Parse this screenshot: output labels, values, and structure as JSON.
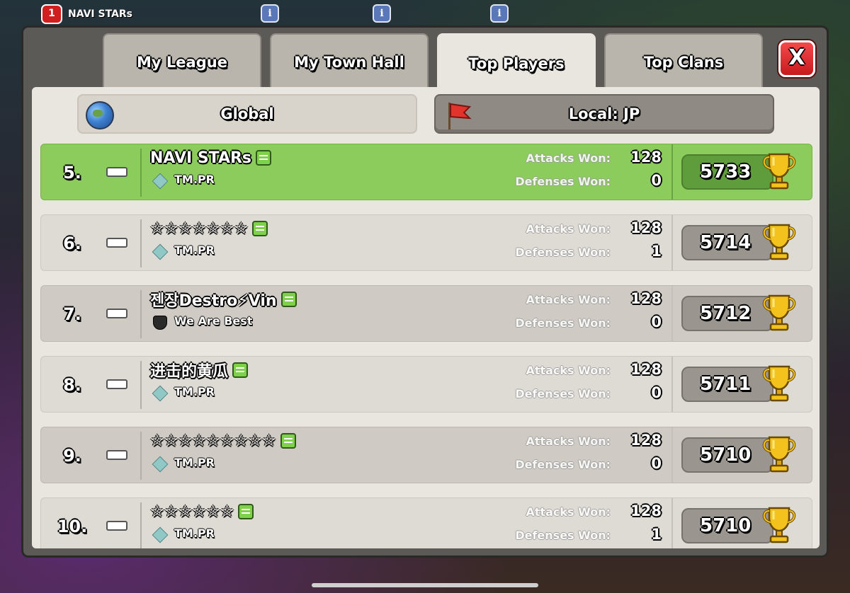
{
  "top": {
    "notification_count": "1",
    "player_name": "NAVI STARs"
  },
  "tabs": [
    {
      "label": "My League"
    },
    {
      "label": "My Town Hall"
    },
    {
      "label": "Top Players"
    },
    {
      "label": "Top Clans"
    }
  ],
  "close_label": "X",
  "filters": {
    "global": "Global",
    "local": "Local: JP"
  },
  "stat_labels": {
    "attacks": "Attacks Won:",
    "defenses": "Defenses Won:"
  },
  "rows": [
    {
      "rank": "5.",
      "name": "NAVI STARs",
      "clan": "TM.PR",
      "attacks": "128",
      "defenses": "0",
      "trophies": "5733"
    },
    {
      "rank": "6.",
      "name": "☆☆☆☆☆☆☆",
      "clan": "TM.PR",
      "attacks": "128",
      "defenses": "1",
      "trophies": "5714"
    },
    {
      "rank": "7.",
      "name": "젠장Destro⚡Vin",
      "clan": "We Are Best",
      "attacks": "128",
      "defenses": "0",
      "trophies": "5712"
    },
    {
      "rank": "8.",
      "name": "进击的黄瓜",
      "clan": "TM.PR",
      "attacks": "128",
      "defenses": "0",
      "trophies": "5711"
    },
    {
      "rank": "9.",
      "name": "☆☆☆☆☆☆☆☆☆",
      "clan": "TM.PR",
      "attacks": "128",
      "defenses": "0",
      "trophies": "5710"
    },
    {
      "rank": "10.",
      "name": "☆☆☆☆☆☆",
      "clan": "TM.PR",
      "attacks": "128",
      "defenses": "1",
      "trophies": "5710"
    }
  ]
}
